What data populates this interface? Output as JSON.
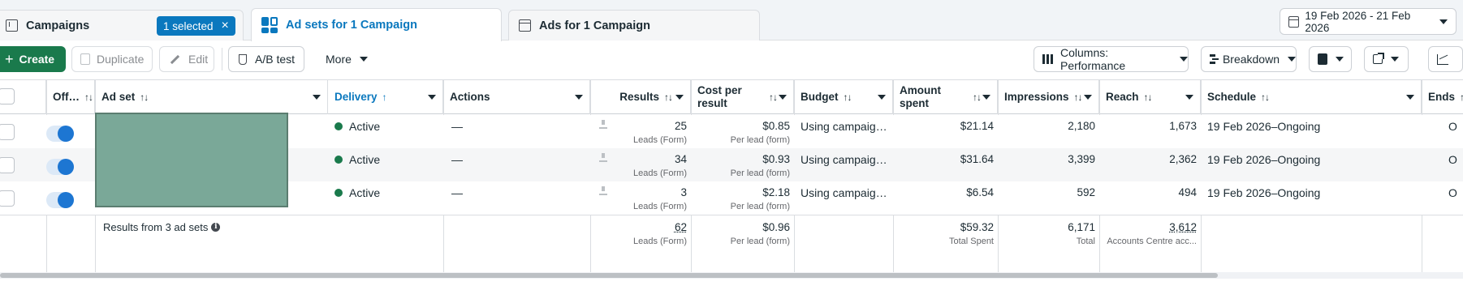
{
  "tabs": {
    "campaigns": {
      "label": "Campaigns",
      "selected_pill": "1 selected",
      "pill_close": "×"
    },
    "adsets": {
      "label": "Ad sets for 1 Campaign"
    },
    "ads": {
      "label": "Ads for 1 Campaign"
    }
  },
  "date_range": "19 Feb 2026 - 21 Feb 2026",
  "toolbar": {
    "create": "Create",
    "create_plus": "+",
    "duplicate": "Duplicate",
    "edit": "Edit",
    "ab_test": "A/B test",
    "more": "More",
    "columns": "Columns: Performance",
    "breakdown": "Breakdown"
  },
  "columns": {
    "off_on": "Off…",
    "sort_glyph": "↑↓",
    "ad_set": "Ad set",
    "delivery": "Delivery",
    "delivery_sort": "↑",
    "actions": "Actions",
    "results": "Results",
    "cost_per_result": "Cost per result",
    "budget": "Budget",
    "amount_spent": "Amount spent",
    "impressions": "Impressions",
    "reach": "Reach",
    "schedule": "Schedule",
    "ends": "Ends"
  },
  "rows": [
    {
      "delivery": "Active",
      "actions": "—",
      "results": "25",
      "results_sub": "Leads (Form)",
      "cost": "$0.85",
      "cost_sub": "Per lead (form)",
      "budget": "Using campaign budget",
      "spent": "$21.14",
      "impressions": "2,180",
      "reach": "1,673",
      "schedule": "19 Feb 2026–Ongoing",
      "ends": "O"
    },
    {
      "delivery": "Active",
      "actions": "—",
      "results": "34",
      "results_sub": "Leads (Form)",
      "cost": "$0.93",
      "cost_sub": "Per lead (form)",
      "budget": "Using campaign budget",
      "spent": "$31.64",
      "impressions": "3,399",
      "reach": "2,362",
      "schedule": "19 Feb 2026–Ongoing",
      "ends": "O"
    },
    {
      "delivery": "Active",
      "actions": "—",
      "results": "3",
      "results_sub": "Leads (Form)",
      "cost": "$2.18",
      "cost_sub": "Per lead (form)",
      "budget": "Using campaign budget",
      "spent": "$6.54",
      "impressions": "592",
      "reach": "494",
      "schedule": "19 Feb 2026–Ongoing",
      "ends": "O"
    }
  ],
  "totals": {
    "label": "Results from 3 ad sets",
    "info_glyph": "i",
    "results": "62",
    "results_sub": "Leads (Form)",
    "cost": "$0.96",
    "cost_sub": "Per lead (form)",
    "spent": "$59.32",
    "spent_sub": "Total Spent",
    "impressions": "6,171",
    "impressions_sub": "Total",
    "reach": "3,612",
    "reach_sub": "Accounts Centre acc..."
  },
  "colors": {
    "accent": "#0a78be",
    "create_button": "#1a7a4c",
    "active_dot": "#1a7a4c",
    "toggle_on": "#1d76d2"
  }
}
